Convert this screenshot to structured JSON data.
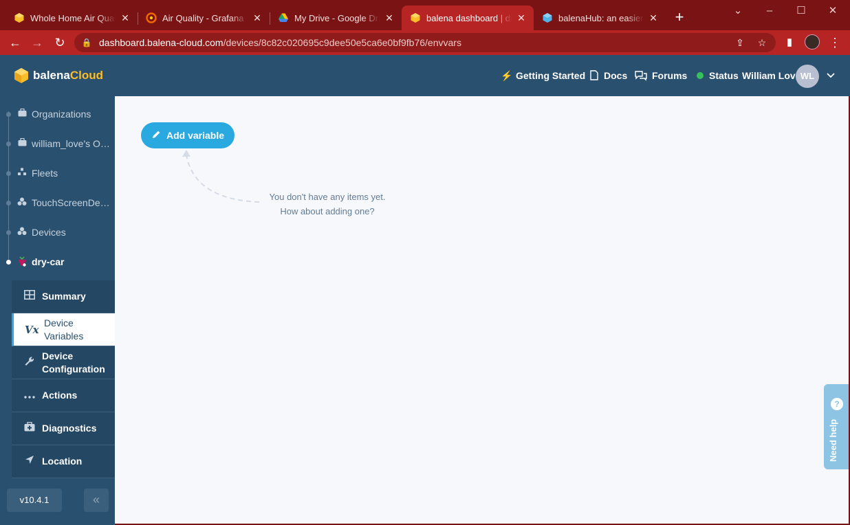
{
  "browser": {
    "tabs": [
      {
        "title": "Whole Home Air Quality",
        "favicon": "balena-cube-icon",
        "active": false
      },
      {
        "title": "Air Quality - Grafana",
        "favicon": "grafana-icon",
        "active": false
      },
      {
        "title": "My Drive - Google Drive",
        "favicon": "google-drive-icon",
        "active": false
      },
      {
        "title": "balena dashboard | dry-car",
        "favicon": "balena-cube-icon",
        "active": true
      },
      {
        "title": "balenaHub: an easier way",
        "favicon": "balenahub-icon",
        "active": false
      }
    ],
    "url_host": "dashboard.balena-cloud.com",
    "url_path": "/devices/8c82c020695c9dee50e5ca6e0bf9fb76/envvars",
    "chrome_color": "#b62424"
  },
  "header": {
    "logo_part1": "balena",
    "logo_part2": "Cloud",
    "links": {
      "getting_started": "Getting Started",
      "docs": "Docs",
      "forums": "Forums",
      "status": "Status"
    },
    "user_name": "William Love",
    "user_initials": "WL"
  },
  "sidebar": {
    "breadcrumbs": [
      {
        "label": "Organizations",
        "icon": "briefcase-icon"
      },
      {
        "label": "william_love's Organization",
        "icon": "briefcase-icon"
      },
      {
        "label": "Fleets",
        "icon": "fleet-icon"
      },
      {
        "label": "TouchScreenDevice",
        "icon": "fleet-cubes-icon"
      },
      {
        "label": "Devices",
        "icon": "devices-icon"
      },
      {
        "label": "dry-car",
        "icon": "raspberry-pi-icon"
      }
    ],
    "menu": [
      {
        "label": "Summary",
        "icon": "table-icon",
        "active": false
      },
      {
        "label": "Device Variables",
        "icon": "vx-icon",
        "icon_text": "Vx",
        "active": true
      },
      {
        "label": "Device Configuration",
        "icon": "wrench-icon",
        "active": false
      },
      {
        "label": "Actions",
        "icon": "ellipsis-icon",
        "active": false
      },
      {
        "label": "Diagnostics",
        "icon": "first-aid-icon",
        "active": false
      },
      {
        "label": "Location",
        "icon": "location-arrow-icon",
        "active": false
      }
    ],
    "version": "v10.4.1"
  },
  "main": {
    "add_button": "Add variable",
    "empty_line1": "You don't have any items yet.",
    "empty_line2": "How about adding one?",
    "need_help": "Need help"
  },
  "colors": {
    "header_bg": "#2a506f",
    "accent": "#2aa8e0",
    "logo_yellow": "#fbbd2a",
    "status_green": "#37c15a"
  }
}
